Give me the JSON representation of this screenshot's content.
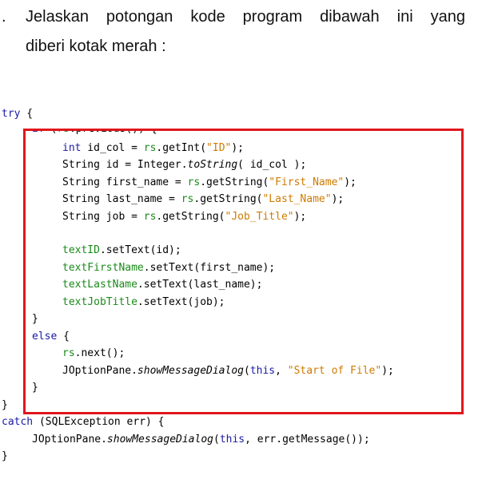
{
  "question": {
    "number": ".",
    "line1": "Jelaskan potongan kode program dibawah ini yang",
    "line2": "diberi kotak merah :"
  },
  "code": {
    "try": "try {",
    "if": "if (rs.previous()) {",
    "l1": "int id_col = rs.getInt(\"ID\");",
    "l2": "String id = Integer.toString( id_col );",
    "l3": "String first_name = rs.getString(\"First_Name\");",
    "l4": "String last_name = rs.getString(\"Last_Name\");",
    "l5": "String job = rs.getString(\"Job_Title\");",
    "l6": "textID.setText(id);",
    "l7": "textFirstName.setText(first_name);",
    "l8": "textLastName.setText(last_name);",
    "l9": "textJobTitle.setText(job);",
    "close1": "}",
    "else": "else {",
    "l10": "rs.next();",
    "l11": "JOptionPane.showMessageDialog(this, \"Start of File\");",
    "close2": "}",
    "close3": "}",
    "catch": "catch (SQLException err) {",
    "l12": "JOptionPane.showMessageDialog(this, err.getMessage());",
    "close4": "}"
  },
  "colors": {
    "keyword": "#1a1aa6",
    "string": "#ce7b00",
    "field": "#1a8a1a",
    "highlight_box": "#e0171c"
  }
}
